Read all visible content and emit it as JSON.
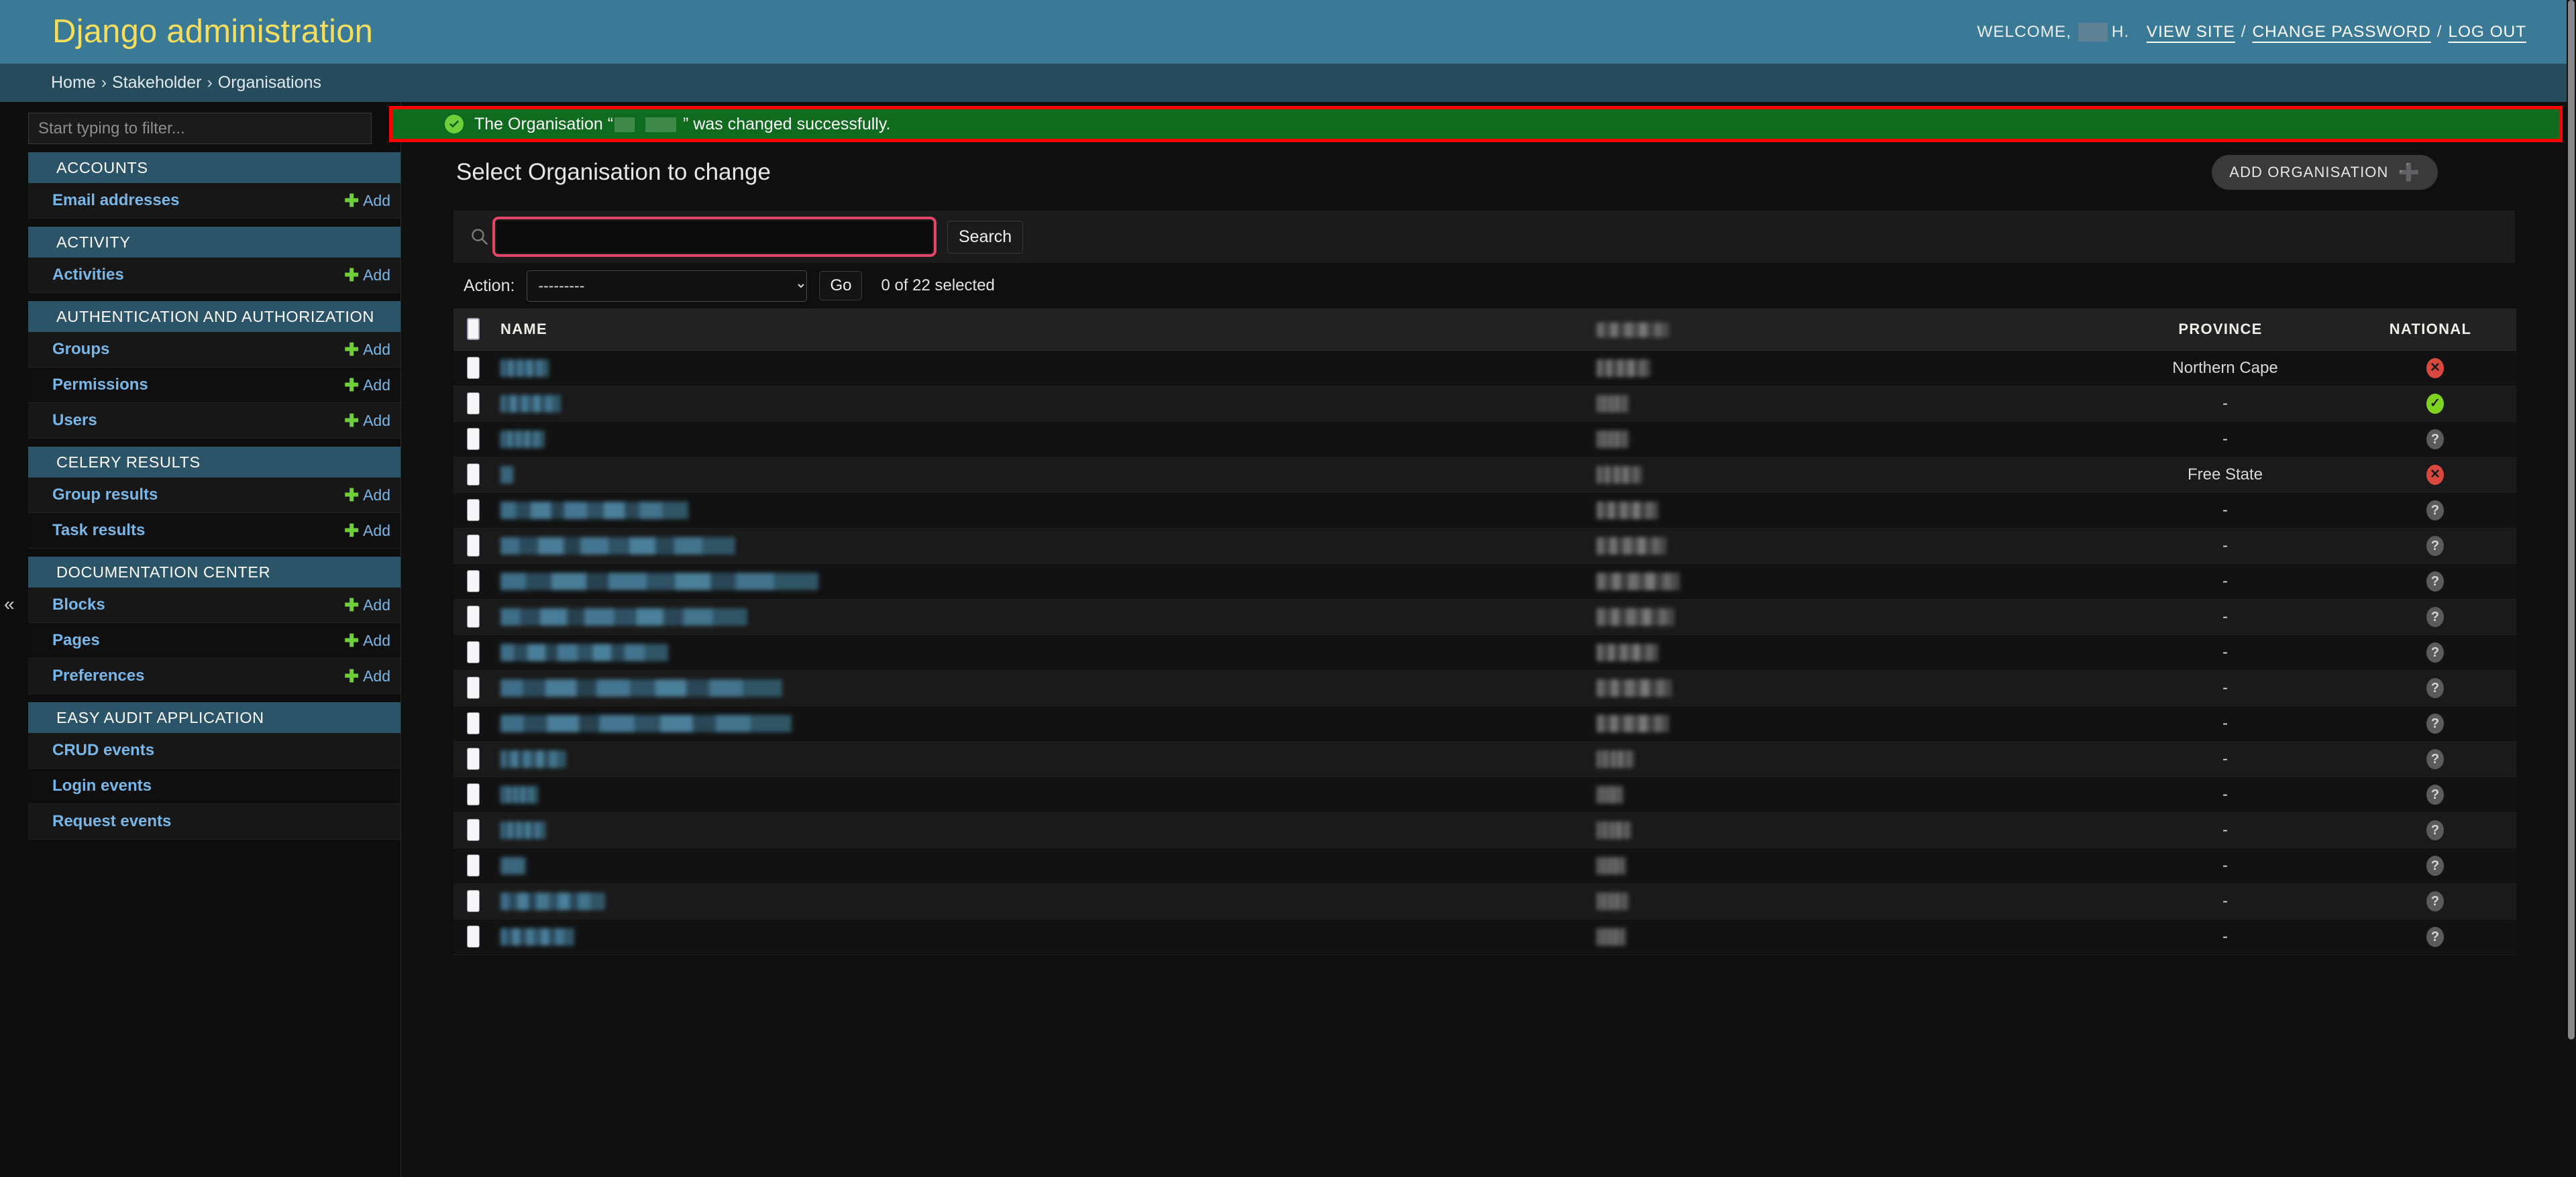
{
  "header": {
    "site_title": "Django administration",
    "welcome_prefix": "WELCOME,",
    "username_redacted": "",
    "username_suffix": "H.",
    "links": [
      {
        "label": "VIEW SITE"
      },
      {
        "label": "CHANGE PASSWORD"
      },
      {
        "label": "LOG OUT"
      }
    ],
    "separator": "/"
  },
  "breadcrumbs": {
    "separator": "›",
    "items": [
      {
        "label": "Home"
      },
      {
        "label": "Stakeholder"
      },
      {
        "label": "Organisations"
      }
    ]
  },
  "sidebar": {
    "filter_placeholder": "Start typing to filter...",
    "filter_value": "",
    "toggle_icon": "«",
    "add_label": "Add",
    "modules": [
      {
        "caption": "ACCOUNTS",
        "items": [
          {
            "label": "Email addresses",
            "has_add": true
          }
        ]
      },
      {
        "caption": "ACTIVITY",
        "items": [
          {
            "label": "Activities",
            "has_add": true
          }
        ]
      },
      {
        "caption": "AUTHENTICATION AND AUTHORIZATION",
        "items": [
          {
            "label": "Groups",
            "has_add": true
          },
          {
            "label": "Permissions",
            "has_add": true
          },
          {
            "label": "Users",
            "has_add": true
          }
        ]
      },
      {
        "caption": "CELERY RESULTS",
        "items": [
          {
            "label": "Group results",
            "has_add": true
          },
          {
            "label": "Task results",
            "has_add": true
          }
        ]
      },
      {
        "caption": "DOCUMENTATION CENTER",
        "items": [
          {
            "label": "Blocks",
            "has_add": true
          },
          {
            "label": "Pages",
            "has_add": true
          },
          {
            "label": "Preferences",
            "has_add": true
          }
        ]
      },
      {
        "caption": "EASY AUDIT APPLICATION",
        "items": [
          {
            "label": "CRUD events",
            "has_add": false
          },
          {
            "label": "Login events",
            "has_add": false
          },
          {
            "label": "Request events",
            "has_add": false
          }
        ]
      }
    ]
  },
  "message": {
    "icon": "check-circle-icon",
    "text_before": "The Organisation “",
    "object_name_redacted": "",
    "text_after": "” was changed successfully.",
    "background_color": "#0f6b1e",
    "highlight_border_color": "#ff0000"
  },
  "main": {
    "title": "Select Organisation to change",
    "add_button_label": "ADD ORGANISATION",
    "add_button_icon": "plus-icon"
  },
  "search": {
    "icon": "search-icon",
    "value": "",
    "placeholder": "",
    "submit_label": "Search",
    "focus_outline_color": "#e04668"
  },
  "actions": {
    "label": "Action:",
    "selected_option": "---------",
    "options": [
      "---------"
    ],
    "go_label": "Go",
    "counter": "0 of 22 selected"
  },
  "table": {
    "select_all_icon": "checkbox-unchecked",
    "columns": [
      {
        "key": "check",
        "label": ""
      },
      {
        "key": "name",
        "label": "NAME"
      },
      {
        "key": "blurred",
        "label": ""
      },
      {
        "key": "province",
        "label": "PROVINCE"
      },
      {
        "key": "national",
        "label": "NATIONAL"
      }
    ],
    "rows": [
      {
        "name_redacted_width": 72,
        "blur2_width": 80,
        "province": "Northern Cape",
        "national": "no"
      },
      {
        "name_redacted_width": 90,
        "blur2_width": 48,
        "province": "-",
        "national": "yes"
      },
      {
        "name_redacted_width": 66,
        "blur2_width": 48,
        "province": "-",
        "national": "unknown"
      },
      {
        "name_redacted_width": 20,
        "blur2_width": 68,
        "province": "Free State",
        "national": "no"
      },
      {
        "name_redacted_width": 280,
        "blur2_width": 92,
        "province": "-",
        "national": "unknown"
      },
      {
        "name_redacted_width": 350,
        "blur2_width": 104,
        "province": "-",
        "national": "unknown"
      },
      {
        "name_redacted_width": 474,
        "blur2_width": 124,
        "province": "-",
        "national": "unknown"
      },
      {
        "name_redacted_width": 368,
        "blur2_width": 116,
        "province": "-",
        "national": "unknown"
      },
      {
        "name_redacted_width": 250,
        "blur2_width": 92,
        "province": "-",
        "national": "unknown"
      },
      {
        "name_redacted_width": 420,
        "blur2_width": 112,
        "province": "-",
        "national": "unknown"
      },
      {
        "name_redacted_width": 434,
        "blur2_width": 108,
        "province": "-",
        "national": "unknown"
      },
      {
        "name_redacted_width": 98,
        "blur2_width": 56,
        "province": "-",
        "national": "unknown"
      },
      {
        "name_redacted_width": 56,
        "blur2_width": 40,
        "province": "-",
        "national": "unknown"
      },
      {
        "name_redacted_width": 68,
        "blur2_width": 52,
        "province": "-",
        "national": "unknown"
      },
      {
        "name_redacted_width": 38,
        "blur2_width": 44,
        "province": "-",
        "national": "unknown"
      },
      {
        "name_redacted_width": 156,
        "blur2_width": 48,
        "province": "-",
        "national": "unknown"
      },
      {
        "name_redacted_width": 110,
        "blur2_width": 44,
        "province": "-",
        "national": "unknown"
      }
    ]
  }
}
